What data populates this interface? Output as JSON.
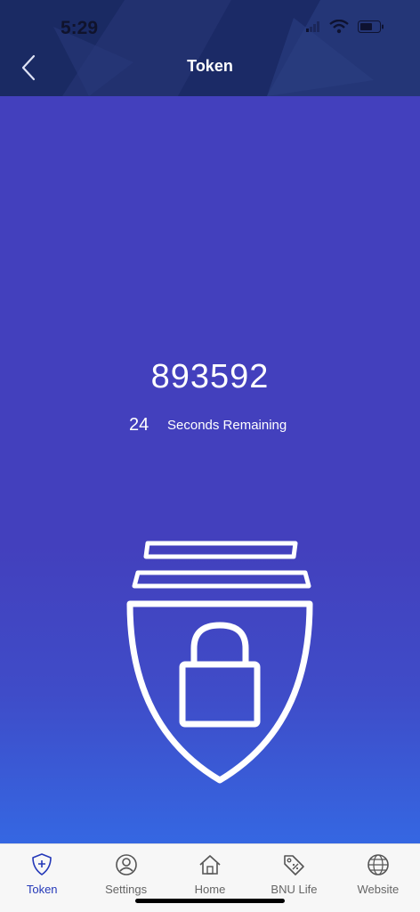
{
  "status_bar": {
    "time": "5:29"
  },
  "header": {
    "title": "Token"
  },
  "token": {
    "code": "893592",
    "seconds": "24",
    "seconds_label": "Seconds Remaining"
  },
  "tabs": [
    {
      "label": "Token",
      "icon": "shield-plus-icon",
      "active": true
    },
    {
      "label": "Settings",
      "icon": "user-circle-icon",
      "active": false
    },
    {
      "label": "Home",
      "icon": "home-icon",
      "active": false
    },
    {
      "label": "BNU Life",
      "icon": "tag-icon",
      "active": false
    },
    {
      "label": "Website",
      "icon": "globe-www-icon",
      "active": false
    }
  ],
  "colors": {
    "accent": "#2438b8",
    "background": "#4340bd",
    "header": "#1c2a66"
  }
}
